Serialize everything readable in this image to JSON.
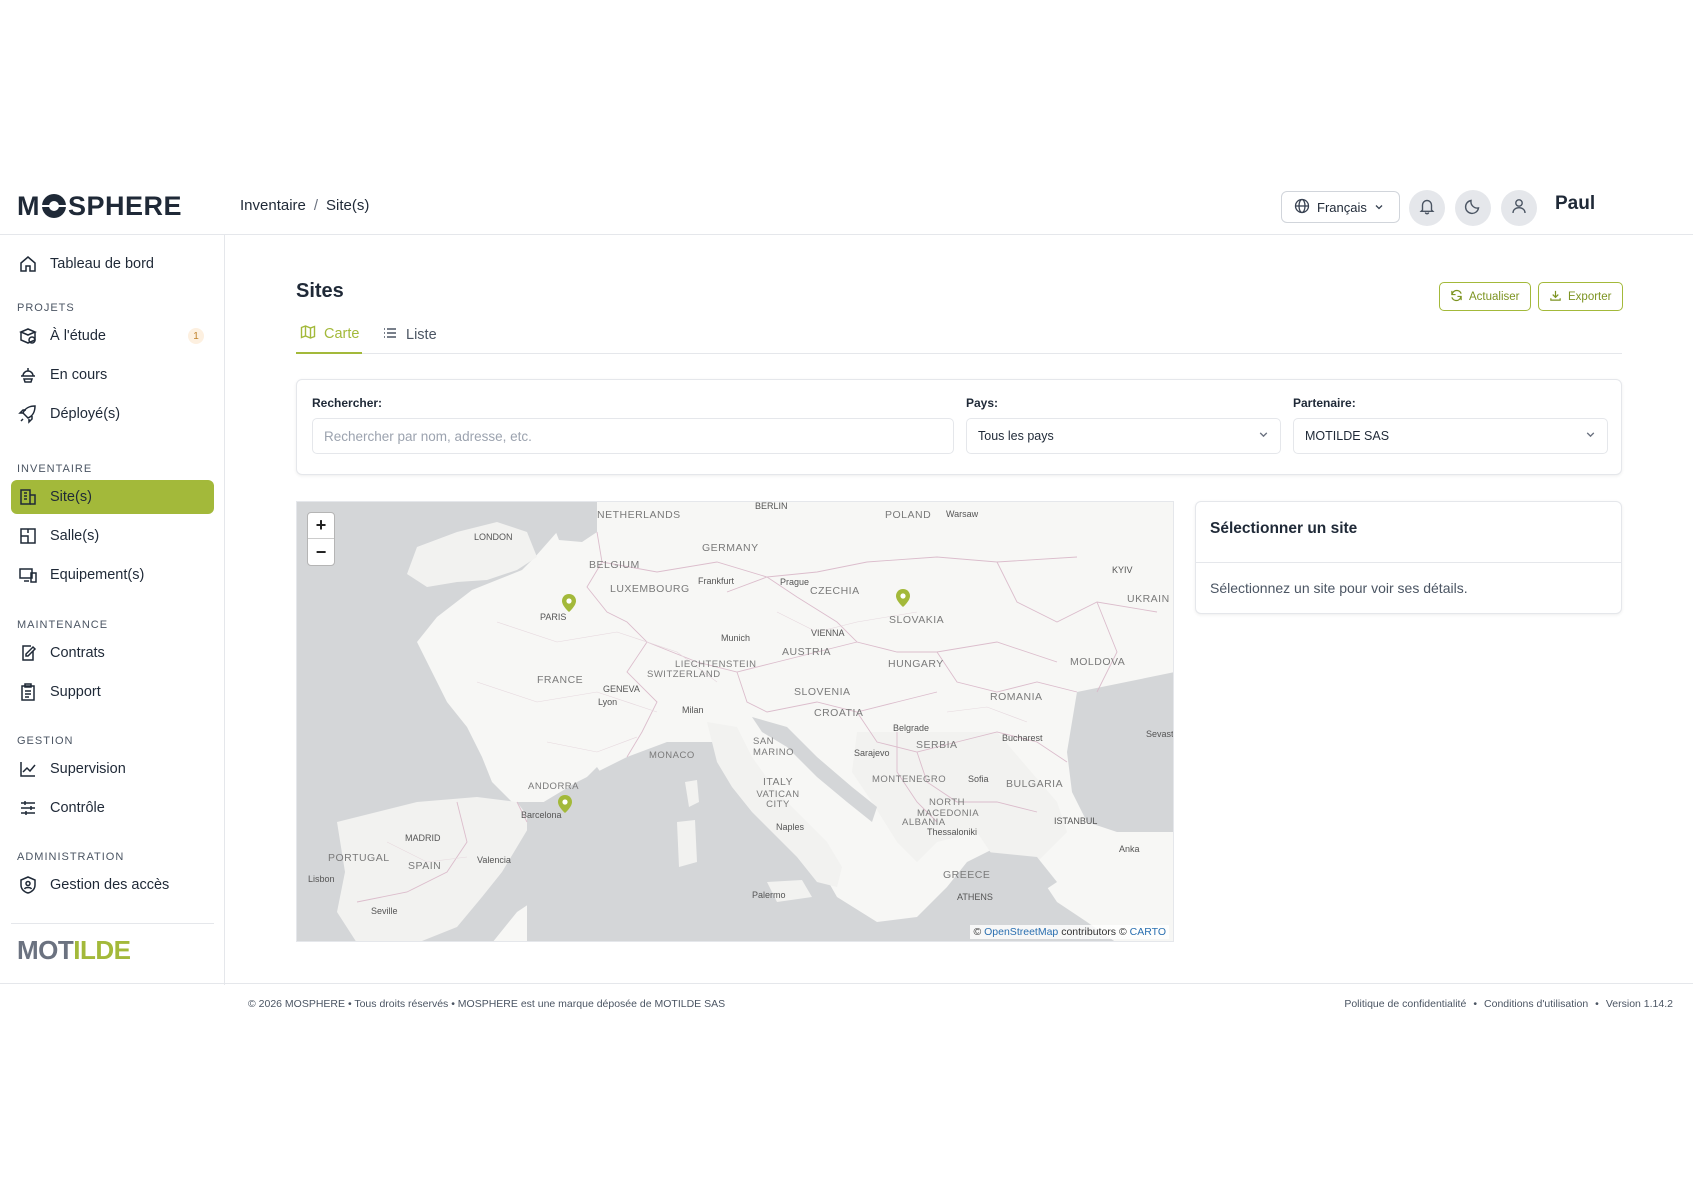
{
  "brand": {
    "logo_left": "M",
    "logo_right": "SPHERE",
    "partner_logo": "MOTILDE",
    "accent_color": "#a3b93a"
  },
  "breadcrumb": {
    "parent": "Inventaire",
    "separator": "/",
    "current": "Site(s)"
  },
  "header": {
    "language": "Français",
    "user_name": "Paul",
    "icons": [
      "globe-icon",
      "bell-icon",
      "moon-icon",
      "user-icon"
    ]
  },
  "sidebar": {
    "dashboard": "Tableau de bord",
    "sections": {
      "projets": "PROJETS",
      "inventaire": "INVENTAIRE",
      "maintenance": "MAINTENANCE",
      "gestion": "GESTION",
      "administration": "ADMINISTRATION"
    },
    "items": {
      "etude": "À l'étude",
      "etude_badge": "1",
      "en_cours": "En cours",
      "deployes": "Déployé(s)",
      "sites": "Site(s)",
      "salles": "Salle(s)",
      "equipements": "Equipement(s)",
      "contrats": "Contrats",
      "support": "Support",
      "supervision": "Supervision",
      "controle": "Contrôle",
      "acces": "Gestion des accès"
    }
  },
  "main": {
    "title": "Sites",
    "refresh_label": "Actualiser",
    "export_label": "Exporter",
    "tabs": {
      "map": "Carte",
      "list": "Liste"
    },
    "filters": {
      "search_label": "Rechercher:",
      "search_placeholder": "Rechercher par nom, adresse, etc.",
      "country_label": "Pays:",
      "country_value": "Tous les pays",
      "partner_label": "Partenaire:",
      "partner_value": "MOTILDE SAS"
    }
  },
  "map": {
    "zoom_in": "+",
    "zoom_out": "−",
    "attribution_prefix": "©",
    "attribution_osm": "OpenStreetMap",
    "attribution_mid": "contributors ©",
    "attribution_carto": "CARTO",
    "country_labels": {
      "netherlands": "NETHERLANDS",
      "poland": "POLAND",
      "germany": "GERMANY",
      "belgium": "BELGIUM",
      "luxembourg": "LUXEMBOURG",
      "czechia": "CZECHIA",
      "slovakia": "SLOVAKIA",
      "ukraine": "UKRAIN",
      "moldova": "MOLDOVA",
      "austria": "AUSTRIA",
      "hungary": "HUNGARY",
      "france": "FRANCE",
      "liechtenstein": "LIECHTENSTEIN",
      "switzerland": "SWITZERLAND",
      "slovenia": "SLOVENIA",
      "croatia": "CROATIA",
      "romania": "ROMANIA",
      "serbia": "SERBIA",
      "monaco": "MONACO",
      "san_marino": "SAN MARINO",
      "andorra": "ANDORRA",
      "italy": "ITALY",
      "vatican": "VATICAN CITY",
      "montenegro": "MONTENEGRO",
      "bulgaria": "BULGARIA",
      "north_macedonia": "NORTH MACEDONIA",
      "albania": "ALBANIA",
      "portugal": "PORTUGAL",
      "spain": "SPAIN",
      "greece": "GREECE"
    },
    "city_labels": {
      "berlin": "BERLIN",
      "warsaw": "Warsaw",
      "london": "LONDON",
      "frankfurt": "Frankfurt",
      "prague": "Prague",
      "kyiv": "KYIV",
      "paris": "PARIS",
      "munich": "Munich",
      "vienna": "VIENNA",
      "geneva": "GENEVA",
      "lyon": "Lyon",
      "milan": "Milan",
      "belgrade": "Belgrade",
      "bucharest": "Bucharest",
      "sevastopol": "Sevast",
      "sarajevo": "Sarajevo",
      "sofia": "Sofia",
      "barcelona": "Barcelona",
      "istanbul": "ISTANBUL",
      "madrid": "MADRID",
      "naples": "Naples",
      "thessaloniki": "Thessaloniki",
      "ankara": "Anka",
      "valencia": "Valencia",
      "lisbon": "Lisbon",
      "palermo": "Palermo",
      "athens": "ATHENS",
      "seville": "Seville"
    }
  },
  "site_panel": {
    "title": "Sélectionner un site",
    "body": "Sélectionnez un site pour voir ses détails."
  },
  "footer": {
    "copyright": "© 2026 MOSPHERE • Tous droits réservés • MOSPHERE est une marque déposée de MOTILDE SAS",
    "privacy": "Politique de confidentialité",
    "terms": "Conditions d'utilisation",
    "dot": "•",
    "version": "Version 1.14.2"
  }
}
